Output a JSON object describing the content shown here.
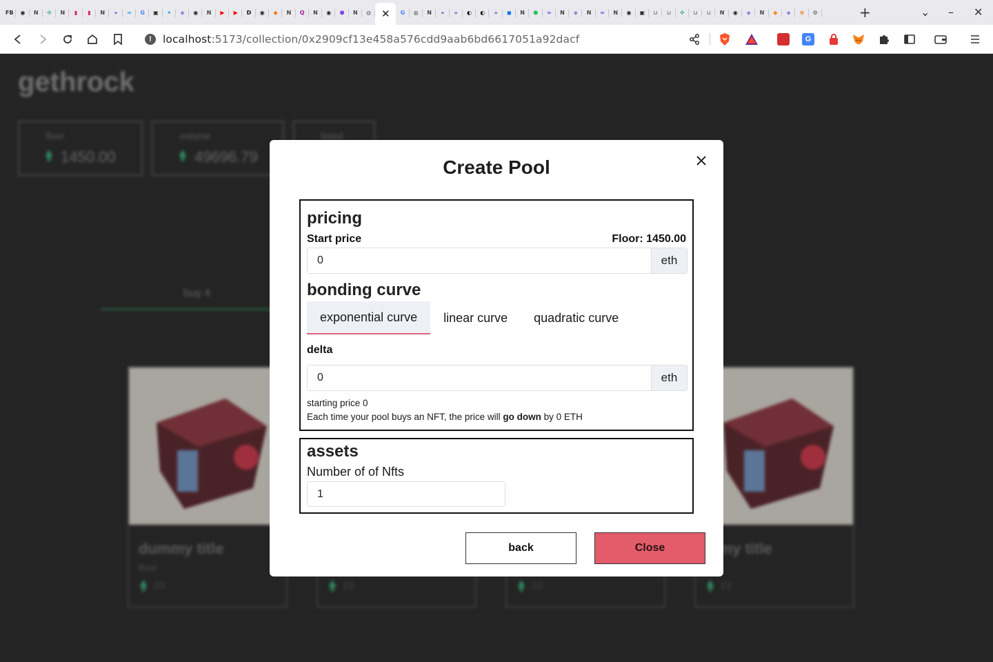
{
  "browser": {
    "tabs": [
      {
        "icon": "facebook-icon",
        "glyph": "FB",
        "color": "#333"
      },
      {
        "icon": "github-icon",
        "glyph": "◉",
        "color": "#222"
      },
      {
        "icon": "notion-icon",
        "glyph": "N",
        "color": "#444"
      },
      {
        "icon": "openai-icon",
        "glyph": "✣",
        "color": "#10a37f"
      },
      {
        "icon": "notion-icon",
        "glyph": "N",
        "color": "#444"
      },
      {
        "icon": "app-icon",
        "glyph": "▮",
        "color": "#e0245e"
      },
      {
        "icon": "app-icon",
        "glyph": "▮",
        "color": "#e0245e"
      },
      {
        "icon": "notion-icon",
        "glyph": "N",
        "color": "#444"
      },
      {
        "icon": "docs-icon",
        "glyph": "»",
        "color": "#4b4bd6"
      },
      {
        "icon": "wave-icon",
        "glyph": "≈",
        "color": "#1da1f2"
      },
      {
        "icon": "google-icon",
        "glyph": "G",
        "color": "#4285f4"
      },
      {
        "icon": "box-icon",
        "glyph": "▣",
        "color": "#222"
      },
      {
        "icon": "twitter-icon",
        "glyph": "✦",
        "color": "#1da1f2"
      },
      {
        "icon": "ethereum-icon",
        "glyph": "◆",
        "color": "#8a92d6"
      },
      {
        "icon": "github-icon",
        "glyph": "◉",
        "color": "#222"
      },
      {
        "icon": "notion-icon",
        "glyph": "N",
        "color": "#444"
      },
      {
        "icon": "youtube-icon",
        "glyph": "▶",
        "color": "#ff0000"
      },
      {
        "icon": "youtube-icon",
        "glyph": "▶",
        "color": "#ff0000"
      },
      {
        "icon": "dev-icon",
        "glyph": "D",
        "color": "#111"
      },
      {
        "icon": "github-icon",
        "glyph": "◉",
        "color": "#222"
      },
      {
        "icon": "shield-icon",
        "glyph": "◆",
        "color": "#f97316"
      },
      {
        "icon": "notion-icon",
        "glyph": "N",
        "color": "#444"
      },
      {
        "icon": "quora-icon",
        "glyph": "Q",
        "color": "#a020a0"
      },
      {
        "icon": "notion-icon",
        "glyph": "N",
        "color": "#444"
      },
      {
        "icon": "github-icon",
        "glyph": "◉",
        "color": "#222"
      },
      {
        "icon": "polygon-icon",
        "glyph": "⬢",
        "color": "#8247e5"
      },
      {
        "icon": "notion-icon",
        "glyph": "N",
        "color": "#444"
      },
      {
        "icon": "globe-icon",
        "glyph": "◍",
        "color": "#666"
      }
    ],
    "tabs_after": [
      {
        "icon": "google-icon",
        "glyph": "G",
        "color": "#4285f4"
      },
      {
        "icon": "globe-icon",
        "glyph": "◍",
        "color": "#555"
      },
      {
        "icon": "notion-icon",
        "glyph": "N",
        "color": "#444"
      },
      {
        "icon": "docs-icon",
        "glyph": "»",
        "color": "#4b4bd6"
      },
      {
        "icon": "docs-icon",
        "glyph": "»",
        "color": "#4b4bd6"
      },
      {
        "icon": "link-icon",
        "glyph": "◐",
        "color": "#111"
      },
      {
        "icon": "link-icon",
        "glyph": "◐",
        "color": "#111"
      },
      {
        "icon": "docs-icon",
        "glyph": "»",
        "color": "#4b4bd6"
      },
      {
        "icon": "bookmark-icon",
        "glyph": "◼",
        "color": "#1a73e8"
      },
      {
        "icon": "notion-icon",
        "glyph": "N",
        "color": "#444"
      },
      {
        "icon": "cube-icon",
        "glyph": "⬢",
        "color": "#22c55e"
      },
      {
        "icon": "wave-icon",
        "glyph": "≈",
        "color": "#7c3aed"
      },
      {
        "icon": "notion-icon",
        "glyph": "N",
        "color": "#444"
      },
      {
        "icon": "ethereum-icon",
        "glyph": "◆",
        "color": "#8a92d6"
      },
      {
        "icon": "notion-icon",
        "glyph": "N",
        "color": "#444"
      },
      {
        "icon": "wave-icon",
        "glyph": "≈",
        "color": "#7c3aed"
      },
      {
        "icon": "notion-icon",
        "glyph": "N",
        "color": "#444"
      },
      {
        "icon": "github-icon",
        "glyph": "◉",
        "color": "#222"
      },
      {
        "icon": "box-icon",
        "glyph": "▣",
        "color": "#222"
      },
      {
        "icon": "bracket-icon",
        "glyph": "⊔",
        "color": "#777"
      },
      {
        "icon": "bracket-icon",
        "glyph": "⊔",
        "color": "#777"
      },
      {
        "icon": "openai-icon",
        "glyph": "✣",
        "color": "#10a37f"
      },
      {
        "icon": "bracket-icon",
        "glyph": "⊔",
        "color": "#777"
      },
      {
        "icon": "bracket-icon",
        "glyph": "⊔",
        "color": "#777"
      },
      {
        "icon": "notion-icon",
        "glyph": "N",
        "color": "#444"
      },
      {
        "icon": "github-icon",
        "glyph": "◉",
        "color": "#222"
      },
      {
        "icon": "ethereum-icon",
        "glyph": "◆",
        "color": "#8a92d6"
      },
      {
        "icon": "notion-icon",
        "glyph": "N",
        "color": "#444"
      },
      {
        "icon": "metamask-icon",
        "glyph": "◆",
        "color": "#f6851b"
      },
      {
        "icon": "ethereum-icon",
        "glyph": "◆",
        "color": "#8a92d6"
      },
      {
        "icon": "stack-icon",
        "glyph": "≡",
        "color": "#f48024"
      },
      {
        "icon": "gear-icon",
        "glyph": "⚙",
        "color": "#555"
      }
    ],
    "url_host": "localhost",
    "url_path": ":5173/collection/0x2909cf13e458a576cdd9aab6bd6617051a92dacf"
  },
  "page": {
    "collection_name": "gethrock",
    "stats": [
      {
        "label": "floor",
        "value": "1450.00"
      },
      {
        "label": "volume",
        "value": "49696.79"
      },
      {
        "label": "listed",
        "value": ""
      }
    ],
    "tab_label": "buy 4",
    "cards": [
      {
        "title": "dummy title",
        "sub": "floor",
        "price": "23"
      },
      {
        "title": "",
        "sub": "",
        "price": "23"
      },
      {
        "title": "",
        "sub": "",
        "price": "23"
      },
      {
        "title": "mmy title",
        "sub": "r",
        "price": "23"
      }
    ]
  },
  "modal": {
    "title": "Create Pool",
    "pricing": {
      "heading": "pricing",
      "start_price_label": "Start price",
      "floor_label": "Floor: 1450.00",
      "start_price_value": "0",
      "unit": "eth"
    },
    "bonding": {
      "heading": "bonding curve",
      "tabs": [
        "exponential curve",
        "linear curve",
        "quadratic curve"
      ],
      "active_tab": 0,
      "delta_label": "delta",
      "delta_value": "0",
      "unit": "eth",
      "starting_price_text": "starting price 0",
      "helper_prefix": "Each time your pool buys an NFT, the price will ",
      "helper_bold": "go down",
      "helper_suffix": " by 0 ETH"
    },
    "assets": {
      "heading": "assets",
      "nfts_label": "Number of of Nfts",
      "nfts_value": "1"
    },
    "buttons": {
      "back": "back",
      "close": "Close"
    }
  }
}
